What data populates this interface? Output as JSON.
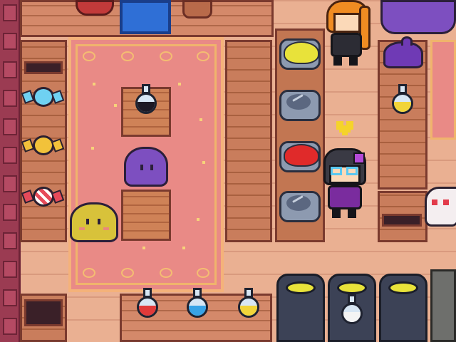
{
  "scene": {
    "type": "top-down pixel-art shop interior",
    "colors": {
      "floor": "#eab092",
      "rug": "#e98a86",
      "counter": "#c97d5c",
      "wall": "#9b3b52"
    }
  },
  "items": {
    "potions_on_counter": [
      {
        "name": "red-potion",
        "color": "#e03a3a"
      },
      {
        "name": "blue-potion",
        "color": "#39a3e6"
      },
      {
        "name": "yellow-potion",
        "color": "#f1d43a"
      }
    ],
    "pedestal_potion": {
      "name": "black-potion",
      "color": "#1e1a26"
    },
    "shelf_potion": {
      "name": "yellow-potion",
      "color": "#f1d43a"
    },
    "jars": [
      {
        "name": "yellow-slime-jar",
        "fill": "#e8e23a"
      },
      {
        "name": "empty-jar",
        "fill": ""
      },
      {
        "name": "red-slime-jar",
        "fill": "#e02a2a"
      },
      {
        "name": "empty-jar",
        "fill": ""
      }
    ],
    "candies": [
      {
        "name": "blue-candy",
        "color": "#6fd1f2"
      },
      {
        "name": "yellow-candy",
        "color": "#f2c23a"
      },
      {
        "name": "red-striped-candy",
        "color": "#e64a5a"
      }
    ],
    "slimes": [
      {
        "name": "purple-slime",
        "color": "#7d4fc0"
      },
      {
        "name": "yellow-slime",
        "color": "#d8c23a"
      },
      {
        "name": "purple-slime-small",
        "color": "#6f3ab5"
      }
    ]
  },
  "characters": [
    {
      "name": "orange-haired-girl"
    },
    {
      "name": "dark-haired-player"
    },
    {
      "name": "white-ghost-creature"
    }
  ],
  "icons": [
    "heart-icon"
  ]
}
